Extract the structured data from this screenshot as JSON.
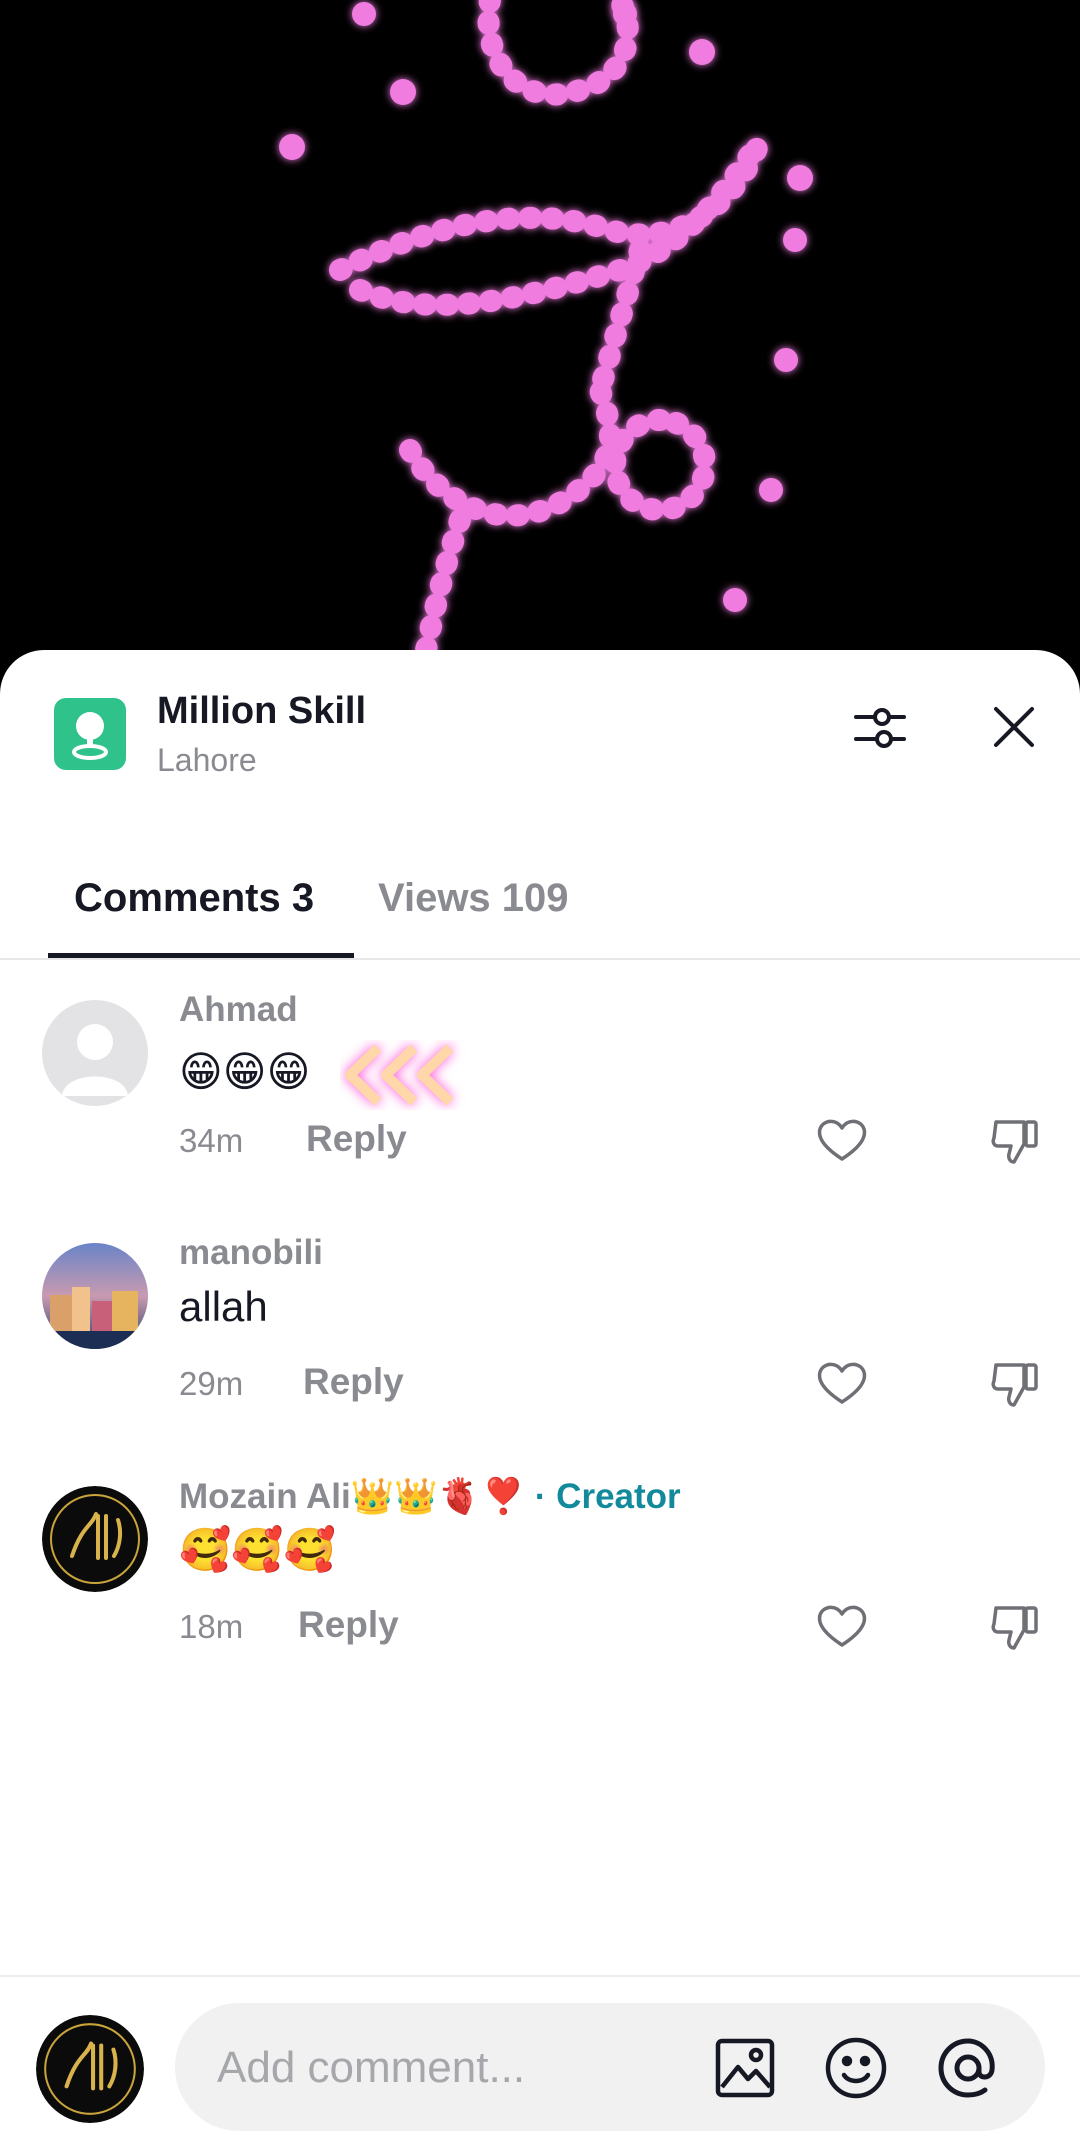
{
  "location": {
    "title": "Million Skill",
    "subtitle": "Lahore",
    "icon": "map-pin-icon",
    "color": "#2fc28b"
  },
  "tabs": [
    {
      "label": "Comments 3",
      "active": true
    },
    {
      "label": "Views 109",
      "active": false
    }
  ],
  "comments": [
    {
      "username": "Ahmad",
      "text": "😁😁😁",
      "time": "34m",
      "reply": "Reply",
      "avatar": "default-avatar"
    },
    {
      "username": "manobili",
      "text": "allah",
      "time": "29m",
      "reply": "Reply",
      "avatar": "city-photo-avatar"
    },
    {
      "username": "Mozain Ali👑👑🫀❣️",
      "badge": " · Creator",
      "text": "🥰🥰🥰",
      "time": "18m",
      "reply": "Reply",
      "avatar": "calligraphy-avatar"
    }
  ],
  "composer": {
    "placeholder": "Add comment...",
    "icons": [
      "image-icon",
      "emoji-icon",
      "mention-icon"
    ]
  },
  "colors": {
    "creator": "#128a9c",
    "muted": "#8a8b91",
    "video_bg": "#000000",
    "stars": "#e85bd8"
  }
}
